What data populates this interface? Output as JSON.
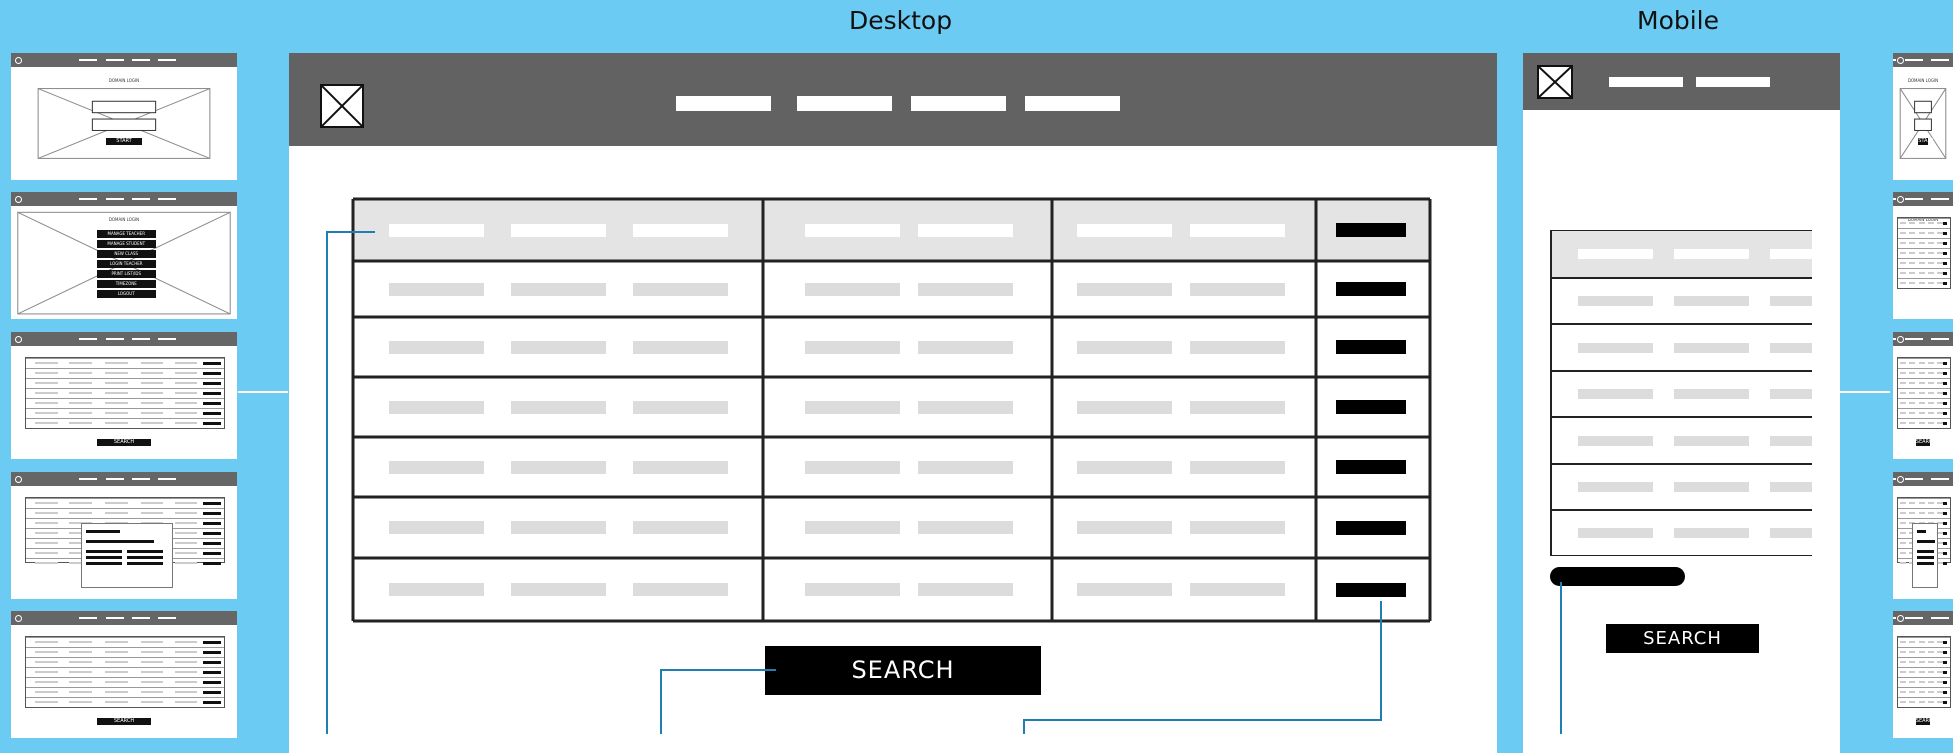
{
  "labels": {
    "desktop": "Desktop",
    "mobile": "Mobile"
  },
  "desktop": {
    "search_label": "SEARCH",
    "nav_item_count": 4,
    "table": {
      "rows": 7
    }
  },
  "mobile": {
    "search_label": "SEARCH",
    "nav_item_count": 2,
    "table": {
      "rows": 7
    }
  },
  "thumbnails": {
    "left": [
      {
        "title": "DOMAIN LOGIN",
        "button": "START"
      },
      {
        "title": "DOMAIN LOGIN",
        "menu": [
          "MANAGE TEACHER",
          "MANAGE STUDENT",
          "NEW CLASS",
          "LOGIN TEACHER",
          "PRINT LIST/IDS",
          "TIMEZONE",
          "LOGOUT"
        ]
      },
      {
        "button": "SEARCH"
      },
      {
        "popup": true
      },
      {
        "button": "SEARCH"
      }
    ],
    "right": [
      {
        "title": "DOMAIN LOGIN",
        "button": "START"
      },
      {
        "title": "DOMAIN LOGIN"
      },
      {
        "button": "SEARCH"
      },
      {
        "popup": true
      },
      {
        "button": "SEARCH"
      }
    ]
  },
  "colors": {
    "background": "#6ccbf3",
    "topbar": "#626262",
    "connector": "#1f7fb5",
    "button": "#000000",
    "placeholder": "#dcdcdc"
  }
}
